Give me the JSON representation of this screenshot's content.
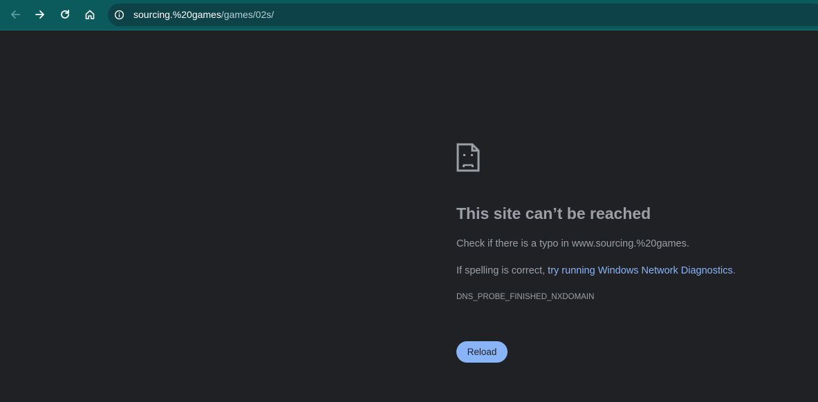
{
  "toolbar": {
    "back_icon": "arrow-left-icon",
    "forward_icon": "arrow-right-icon",
    "reload_icon": "reload-icon",
    "home_icon": "home-icon",
    "accent_color": "#0b5a5c"
  },
  "omnibox": {
    "site_info_icon": "info-icon",
    "url_host": "sourcing.%20games",
    "url_path": "/games/02s/"
  },
  "error": {
    "icon": "sad-page-icon",
    "title": "This site can’t be reached",
    "typo_message": "Check if there is a typo in www.sourcing.%20games.",
    "spelling_prefix": "If spelling is correct, ",
    "diagnostics_link": "try running Windows Network Diagnostics",
    "spelling_suffix": ".",
    "error_code": "DNS_PROBE_FINISHED_NXDOMAIN",
    "reload_label": "Reload"
  },
  "colors": {
    "page_background": "#202124",
    "text": "#9aa0a6",
    "link": "#8ab4f8",
    "button": "#8ab4f8"
  }
}
